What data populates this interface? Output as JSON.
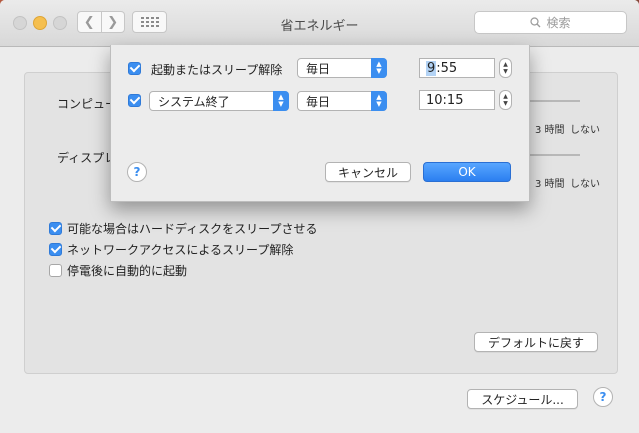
{
  "window": {
    "title": "省エネルギー",
    "search_placeholder": "検索",
    "back_glyph": "❮",
    "forward_glyph": "❯"
  },
  "settings": {
    "computer_label": "コンピュータ",
    "display_label": "ディスプレ",
    "slider_ticks": [
      "3 時間",
      "しない"
    ],
    "checkboxes": [
      {
        "label": "可能な場合はハードディスクをスリープさせる",
        "checked": true
      },
      {
        "label": "ネットワークアクセスによるスリープ解除",
        "checked": true
      },
      {
        "label": "停電後に自動的に起動",
        "checked": false
      }
    ],
    "restore_defaults_label": "デフォルトに戻す",
    "schedule_label": "スケジュール...",
    "help_glyph": "?"
  },
  "sheet": {
    "row1": {
      "checked": true,
      "label": "起動またはスリープ解除",
      "frequency": "毎日",
      "time_hour": "9",
      "time_minute": ":55"
    },
    "row2": {
      "checked": true,
      "action": "システム終了",
      "frequency": "毎日",
      "time": "10:15"
    },
    "cancel_label": "キャンセル",
    "ok_label": "OK",
    "help_glyph": "?"
  },
  "colors": {
    "accent": "#3b8ef0",
    "window_bg": "#ececec",
    "desktop": "#8f4a3a"
  }
}
